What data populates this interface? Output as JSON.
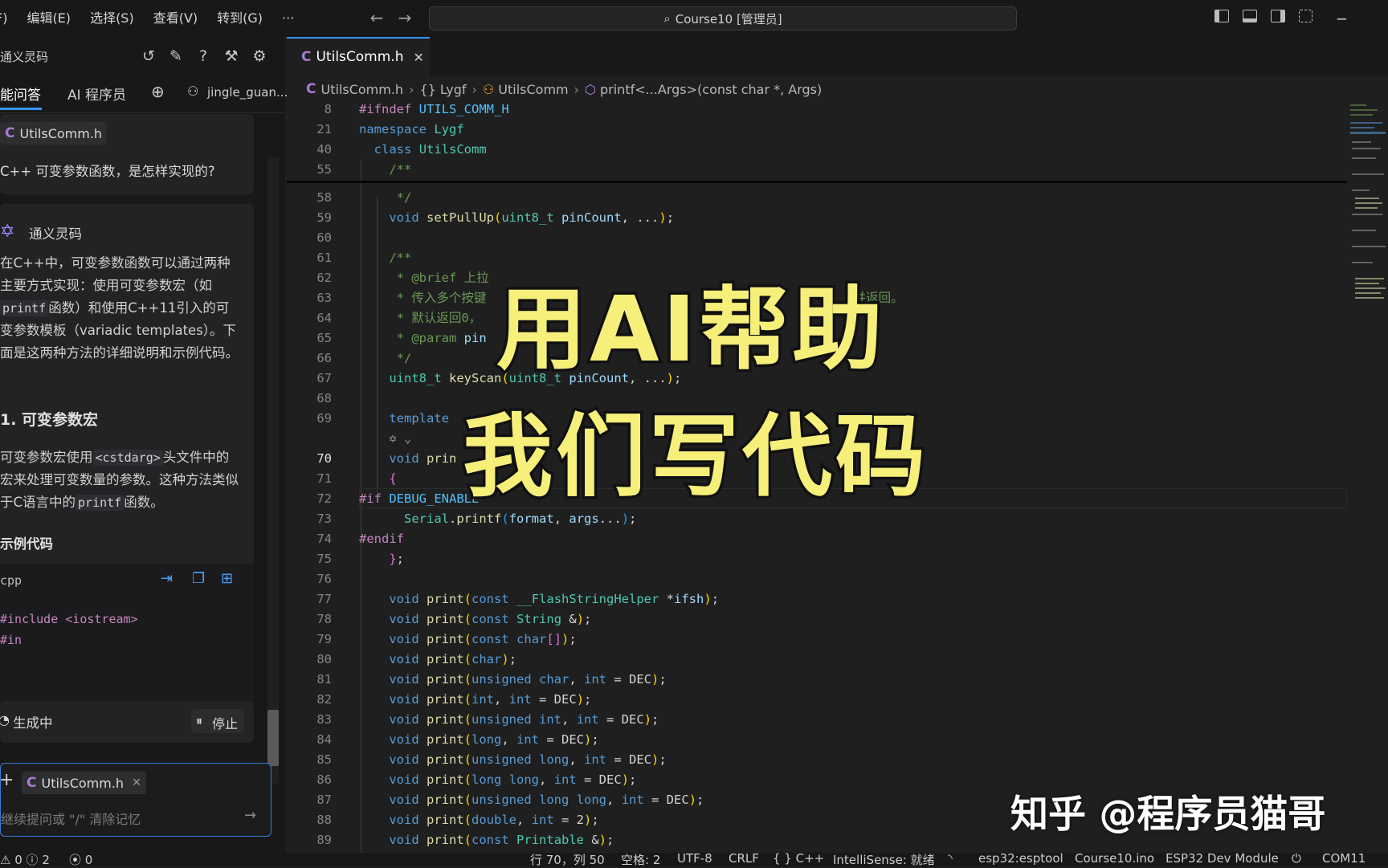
{
  "titlebar": {
    "menu": [
      "F)",
      "编辑(E)",
      "选择(S)",
      "查看(V)",
      "转到(G)",
      "···"
    ],
    "command_center": "Course10 [管理员]"
  },
  "chat": {
    "title": "通义灵码",
    "tabs": [
      "能问答",
      "AI 程序员"
    ],
    "user": "jingle_guan...",
    "question_file": "UtilsComm.h",
    "question": "C++ 可变参数函数，是怎样实现的?",
    "assistant_name": "通义灵码",
    "answer_p1_a": "在C++中，可变参数函数可以通过两种主要方式实现：使用可变参数宏（如",
    "answer_p1_code": "printf",
    "answer_p1_b": "函数）和使用C++11引入的可变参数模板（variadic templates）。下面是这两种方法的详细说明和示例代码。",
    "section1_title": "1. 可变参数宏",
    "p2_a": "可变参数宏使用",
    "p2_code": "<cstdarg>",
    "p2_b": "头文件中的宏来处理可变数量的参数。这种方法类似于C语言中的",
    "p2_code2": "printf",
    "p2_c": "函数。",
    "example_title": "示例代码",
    "code_lang": "cpp",
    "code_line1": "#include <iostream>",
    "code_line2": "#in",
    "generating": "生成中",
    "stop": "停止",
    "input_file": "UtilsComm.h",
    "input_placeholder": "继续提问或 \"/\" 清除记忆"
  },
  "editor": {
    "tab_label": "UtilsComm.h",
    "breadcrumb": [
      "UtilsComm.h",
      "Lygf",
      "UtilsComm",
      "printf<...Args>(const char *, Args)"
    ]
  },
  "overlay": {
    "line1": "用AI帮助",
    "line2": "我们写代码",
    "watermark": "知乎 @程序员猫哥"
  },
  "statusbar": {
    "problems": "0 ⓘ 2",
    "ports": "0",
    "position": "行 70，列 50",
    "spaces": "空格: 2",
    "encoding": "UTF-8",
    "eol": "CRLF",
    "language": "{ } C++",
    "intellisense": "IntelliSense: 就绪",
    "tool": "esp32:esptool",
    "sketch": "Course10.ino",
    "board": "ESP32 Dev Module",
    "port": "COM11"
  },
  "colors": {
    "accent": "#3794ff",
    "overlay_yellow": "#f6ef7a"
  }
}
